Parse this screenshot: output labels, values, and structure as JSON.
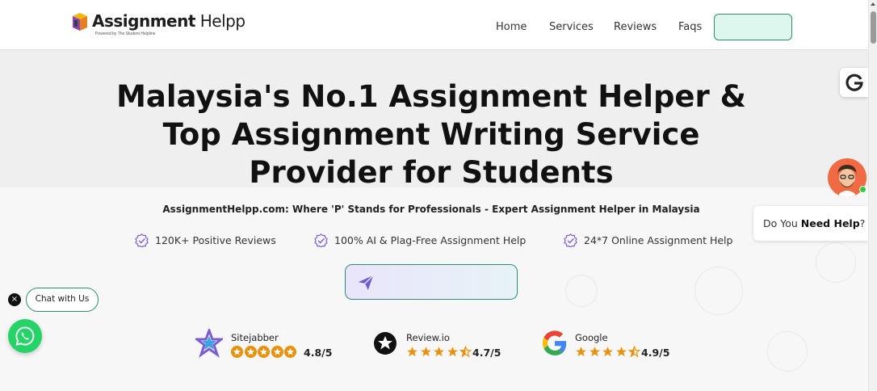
{
  "header": {
    "logo_bold": "Assignment",
    "logo_light": " Helpp",
    "logo_tagline": "Powered by  The Student Helpline",
    "nav": [
      "Home",
      "Services",
      "Reviews",
      "Faqs"
    ],
    "cta_label": ""
  },
  "hero": {
    "title_lines": [
      "Malaysia's No.1 Assignment Helper &",
      "Top Assignment Writing Service",
      "Provider for Students"
    ],
    "subtitle": "AssignmentHelpp.com: Where 'P' Stands for Professionals - Expert Assignment Helper in Malaysia",
    "features": [
      "120K+ Positive Reviews",
      "100% AI & Plag-Free Assignment Help",
      "24*7 Online Assignment Help"
    ],
    "button_label": ""
  },
  "ratings": [
    {
      "name": "Sitejabber",
      "score": "4.8/5",
      "stars": 5,
      "icon": "sitejabber-icon"
    },
    {
      "name": "Review.io",
      "score": "4.7/5",
      "stars": 4.5,
      "icon": "reviewio-icon"
    },
    {
      "name": "Google",
      "score": "4.9/5",
      "stars": 4.5,
      "icon": "google-icon"
    }
  ],
  "widgets": {
    "help_prefix": "Do You ",
    "help_bold": "Need Help",
    "help_suffix": "?",
    "chat_label": "Chat with Us",
    "close_label": "×"
  },
  "colors": {
    "accent": "#2e8f6f",
    "star_orange": "#e8910b",
    "star_purple": "#7b5cd6",
    "whatsapp": "#25d366",
    "avatar_bg": "#f06a43"
  }
}
